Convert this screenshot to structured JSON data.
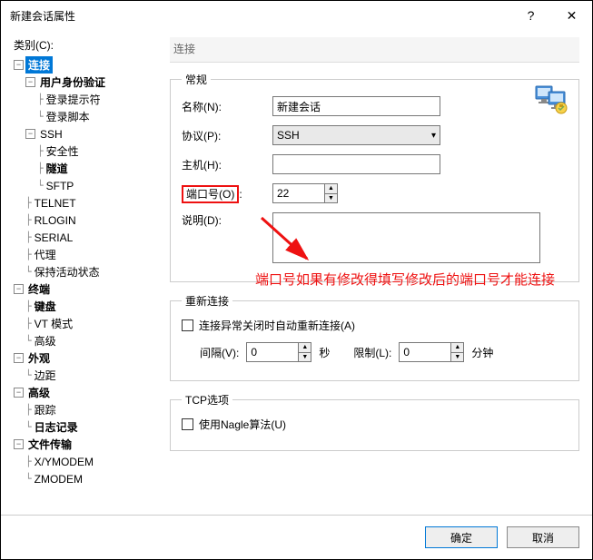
{
  "titlebar": {
    "title": "新建会话属性",
    "help": "?",
    "close": "✕"
  },
  "left": {
    "label": "类别(C):",
    "tree": {
      "connection": "连接",
      "auth": "用户身份验证",
      "login_prompt": "登录提示符",
      "login_script": "登录脚本",
      "ssh": "SSH",
      "security": "安全性",
      "tunnel": "隧道",
      "sftp": "SFTP",
      "telnet": "TELNET",
      "rlogin": "RLOGIN",
      "serial": "SERIAL",
      "proxy": "代理",
      "keepalive": "保持活动状态",
      "terminal": "终端",
      "keyboard": "键盘",
      "vt": "VT 模式",
      "advanced": "高级",
      "appearance": "外观",
      "margin": "边距",
      "advanced2": "高级",
      "trace": "跟踪",
      "log": "日志记录",
      "filetransfer": "文件传输",
      "xymodem": "X/YMODEM",
      "zmodem": "ZMODEM"
    }
  },
  "panel": {
    "title": "连接",
    "groups": {
      "general": "常规",
      "reconnect": "重新连接",
      "tcp": "TCP选项"
    },
    "labels": {
      "name": "名称(N):",
      "protocol": "协议(P):",
      "host": "主机(H):",
      "port": "端口号(O)",
      "colon": ":",
      "desc": "说明(D):",
      "reconnect_cb": "连接异常关闭时自动重新连接(A)",
      "interval": "间隔(V):",
      "sec": "秒",
      "limit": "限制(L):",
      "min": "分钟",
      "nagle": "使用Nagle算法(U)"
    },
    "values": {
      "name": "新建会话",
      "protocol": "SSH",
      "host": "",
      "port": "22",
      "desc": "",
      "interval": "0",
      "limit": "0"
    }
  },
  "annotation": "端口号如果有修改得填写修改后的端口号才能连接",
  "buttons": {
    "ok": "确定",
    "cancel": "取消"
  },
  "toggle": {
    "minus": "−"
  }
}
